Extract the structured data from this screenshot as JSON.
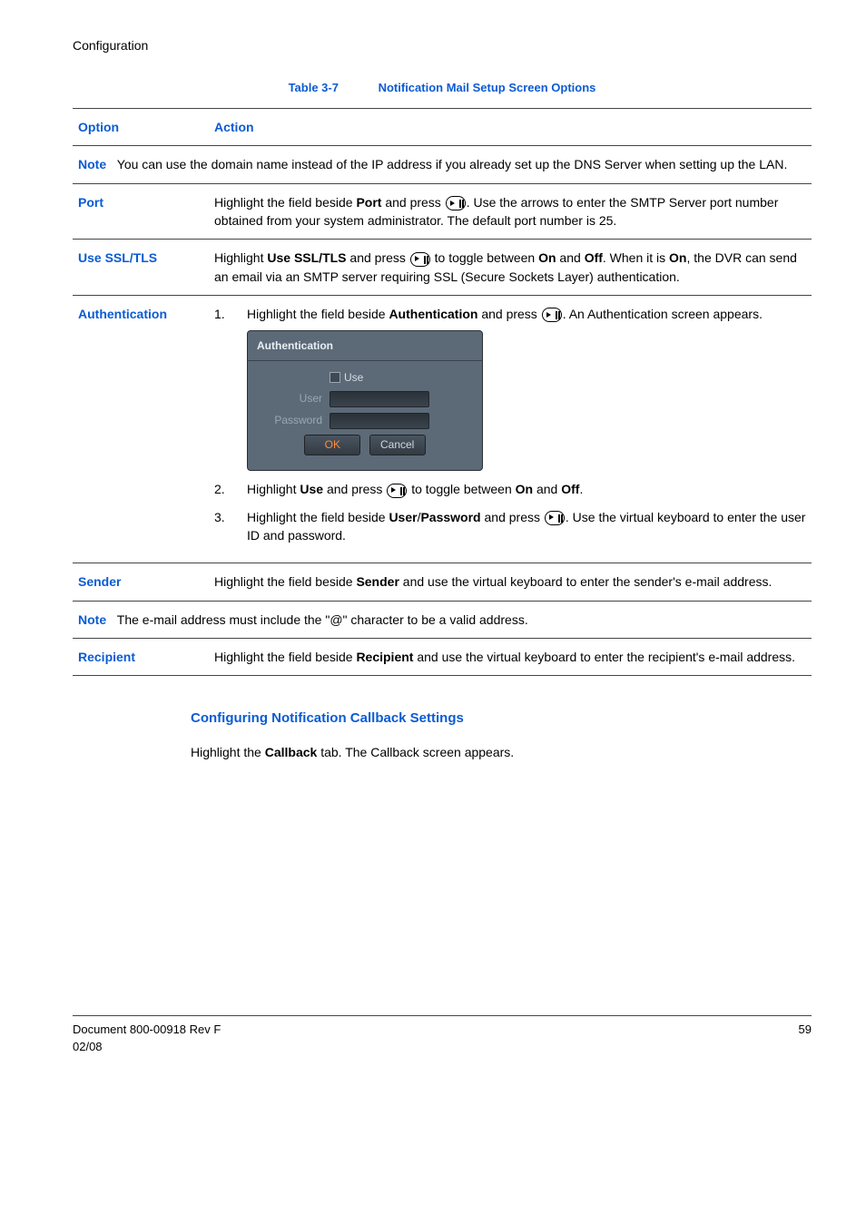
{
  "runningHead": "Configuration",
  "tableCaption": {
    "num": "Table 3-7",
    "title": "Notification Mail Setup Screen Options"
  },
  "headers": {
    "option": "Option",
    "action": "Action"
  },
  "note1": {
    "label": "Note",
    "text": "You can use the domain name instead of the IP address if you already set up the DNS Server when setting up the LAN."
  },
  "port": {
    "label": "Port",
    "t1": "Highlight the field beside ",
    "b1": "Port",
    "t2": " and press ",
    "t3": ". Use the arrows to enter the SMTP Server port number obtained from your system administrator. The default port number is 25."
  },
  "ssl": {
    "label": "Use SSL/TLS",
    "t1": "Highlight ",
    "b1": "Use SSL/TLS",
    "t2": " and press ",
    "t3": " to toggle between ",
    "b2": "On",
    "t4": " and ",
    "b3": "Off",
    "t5": ". When it is ",
    "b4": "On",
    "t6": ", the DVR can send an email via an SMTP server requiring SSL (Secure Sockets Layer) authentication."
  },
  "auth": {
    "label": "Authentication",
    "s1n": "1.",
    "s1a": "Highlight the field beside ",
    "s1b": "Authentication",
    "s1c": " and press ",
    "s1d": ". An Authentication screen appears.",
    "dlgTitle": "Authentication",
    "useLabel": "Use",
    "userLabel": "User",
    "passLabel": "Password",
    "okBtn": "OK",
    "cancelBtn": "Cancel",
    "s2n": "2.",
    "s2a": "Highlight ",
    "s2b": "Use",
    "s2c": " and press ",
    "s2d": " to toggle between ",
    "s2e": "On",
    "s2f": " and ",
    "s2g": "Off",
    "s2h": ".",
    "s3n": "3.",
    "s3a": "Highlight the field beside ",
    "s3b": "User",
    "s3slash": "/",
    "s3c": "Password",
    "s3d": " and press ",
    "s3e": ". Use the virtual keyboard to enter the user ID and password."
  },
  "sender": {
    "label": "Sender",
    "t1": "Highlight the field beside ",
    "b1": "Sender",
    "t2": " and use the virtual keyboard to enter the sender's e-mail address."
  },
  "note2": {
    "label": "Note",
    "text": "The e-mail address must include the \"@\" character to be a valid address."
  },
  "recipient": {
    "label": "Recipient",
    "t1": "Highlight the field beside ",
    "b1": "Recipient",
    "t2": " and use the virtual keyboard to enter the recipient's e-mail address."
  },
  "subheading": "Configuring Notification Callback Settings",
  "para": {
    "t1": "Highlight the ",
    "b1": "Callback",
    "t2": " tab. The Callback screen appears."
  },
  "footer": {
    "left1": "Document 800-00918 Rev F",
    "left2": "02/08",
    "right": "59"
  }
}
